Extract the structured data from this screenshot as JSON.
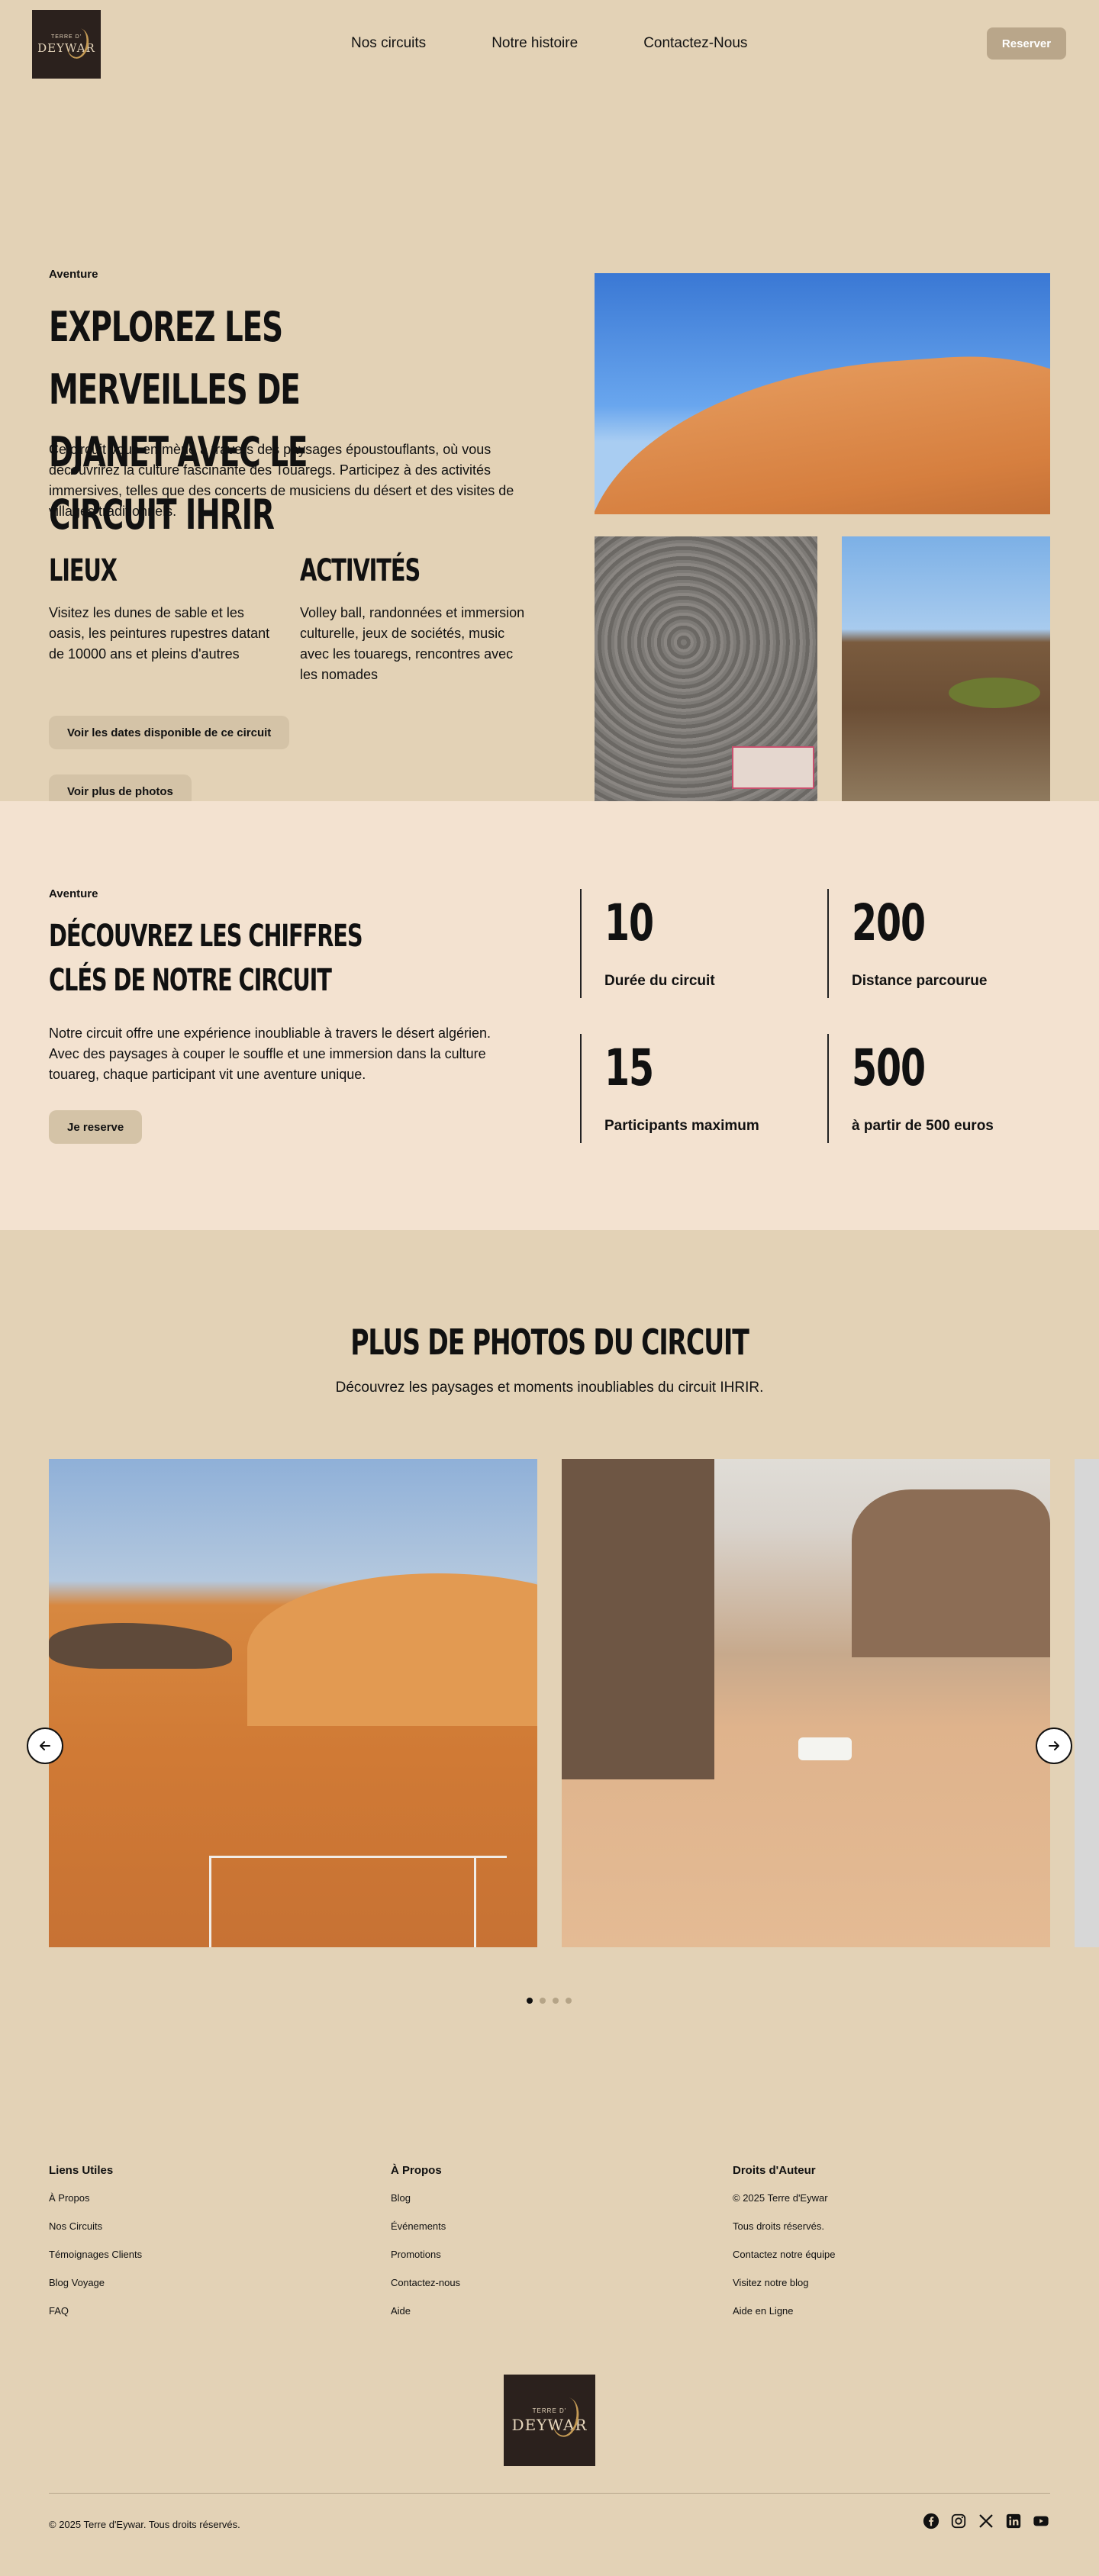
{
  "header": {
    "logo": {
      "small": "TERRE D'",
      "word": "DEYWAR"
    },
    "nav": [
      "Nos circuits",
      "Notre histoire",
      "Contactez-Nous"
    ],
    "reserve_label": "Reserver"
  },
  "hero": {
    "eyebrow": "Aventure",
    "title": "EXPLOREZ LES MERVEILLES DE DJANET AVEC LE CIRCUIT IHRIR",
    "description": "Ce circuit vous emmène à travers des paysages époustouflants, où vous découvrirez la culture fascinante des Touaregs. Participez à des activités immersives, telles que des concerts de musiciens du désert et des visites de villages traditionnels.",
    "lieux": {
      "heading": "LIEUX",
      "text": "Visitez les dunes de sable et les oasis, les peintures rupestres datant de 10000 ans et pleins d'autres"
    },
    "activites": {
      "heading": "ACTIVITÉS",
      "text": "Volley ball, randonnées et immersion culturelle, jeux de sociétés, music avec les touaregs, rencontres avec les nomades"
    },
    "dates_button": "Voir les dates disponible de ce circuit",
    "photos_button": "Voir plus de photos"
  },
  "stats": {
    "eyebrow": "Aventure",
    "title": "DÉCOUVREZ LES CHIFFRES CLÉS DE NOTRE CIRCUIT",
    "description": "Notre circuit offre une expérience inoubliable à travers le désert algérien. Avec des paysages à couper le souffle et une immersion dans la culture touareg, chaque participant vit une aventure unique.",
    "reserve_button": "Je reserve",
    "items": [
      {
        "number": "10",
        "label": "Durée du circuit"
      },
      {
        "number": "200",
        "label": "Distance parcourue"
      },
      {
        "number": "15",
        "label": "Participants maximum"
      },
      {
        "number": "500",
        "label": "à partir de 500 euros"
      }
    ]
  },
  "gallery": {
    "title": "PLUS DE PHOTOS DU CIRCUIT",
    "subtitle": "Découvrez les paysages et moments inoubliables du circuit IHRIR.",
    "prev_icon": "arrow-left-icon",
    "next_icon": "arrow-right-icon",
    "slide_count": 4,
    "active_slide": 1
  },
  "footer": {
    "columns": [
      {
        "heading": "Liens Utiles",
        "links": [
          "À Propos",
          "Nos Circuits",
          "Témoignages Clients",
          "Blog Voyage",
          "FAQ"
        ]
      },
      {
        "heading": "À Propos",
        "links": [
          "Blog",
          "Événements",
          "Promotions",
          "Contactez-nous",
          "Aide"
        ]
      },
      {
        "heading": "Droits d'Auteur",
        "links": [
          "© 2025 Terre d'Eywar",
          "Tous droits réservés.",
          "Contactez notre équipe",
          "Visitez notre blog",
          "Aide en Ligne"
        ]
      }
    ],
    "copyright": "© 2025 Terre d'Eywar. Tous droits réservés.",
    "socials": [
      "facebook-icon",
      "instagram-icon",
      "x-icon",
      "linkedin-icon",
      "youtube-icon"
    ]
  },
  "colors": {
    "background": "#e3d2b6",
    "stats_background": "#f3e2d0",
    "button": "#d4c3a7",
    "reserve_button": "#b9a68a",
    "logo_bg": "#2b211d"
  }
}
